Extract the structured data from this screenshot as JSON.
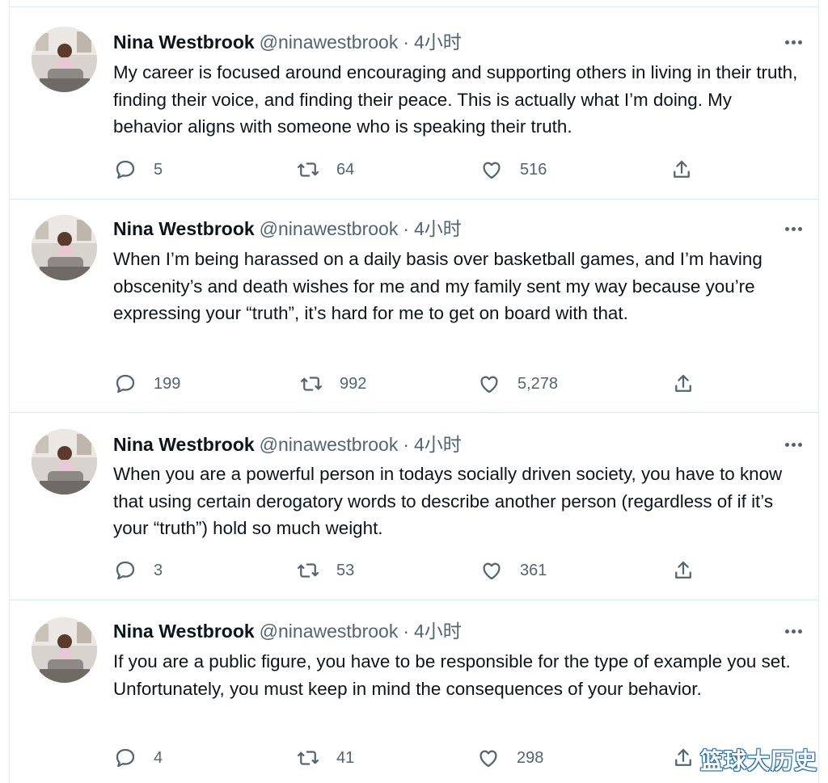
{
  "colors": {
    "text_primary": "#0f1419",
    "text_secondary": "#536471",
    "divider": "#e1e8ed",
    "background": "#ffffff"
  },
  "tweets": [
    {
      "author_name": "Nina Westbrook",
      "author_handle": "@ninawestbrook",
      "separator": "·",
      "timestamp": "4小时",
      "text": "My career is focused around encouraging and supporting others in living in their truth, finding their voice, and finding their peace. This is actually what I’m doing. My behavior aligns with someone who is speaking their truth.",
      "reply_count": "5",
      "retweet_count": "64",
      "like_count": "516",
      "icons": [
        "reply-icon",
        "retweet-icon",
        "like-icon",
        "share-icon",
        "more-icon"
      ]
    },
    {
      "author_name": "Nina Westbrook",
      "author_handle": "@ninawestbrook",
      "separator": "·",
      "timestamp": "4小时",
      "text": "When I’m being harassed on a daily basis over basketball games, and I’m having obscenity’s and death wishes for me and my family sent my way because you’re expressing your “truth”, it’s hard for me to get on board with that.",
      "reply_count": "199",
      "retweet_count": "992",
      "like_count": "5,278",
      "icons": [
        "reply-icon",
        "retweet-icon",
        "like-icon",
        "share-icon",
        "more-icon"
      ]
    },
    {
      "author_name": "Nina Westbrook",
      "author_handle": "@ninawestbrook",
      "separator": "·",
      "timestamp": "4小时",
      "text": "When you are a powerful person in todays socially driven society, you have to know that using certain derogatory words to describe another person (regardless of if it’s your “truth”) hold so much weight.",
      "reply_count": "3",
      "retweet_count": "53",
      "like_count": "361",
      "icons": [
        "reply-icon",
        "retweet-icon",
        "like-icon",
        "share-icon",
        "more-icon"
      ]
    },
    {
      "author_name": "Nina Westbrook",
      "author_handle": "@ninawestbrook",
      "separator": "·",
      "timestamp": "4小时",
      "text": "If you are a public figure, you have to be responsible for the type of example you set. Unfortunately, you must keep in mind the consequences of your behavior.",
      "reply_count": "4",
      "retweet_count": "41",
      "like_count": "298",
      "icons": [
        "reply-icon",
        "retweet-icon",
        "like-icon",
        "share-icon",
        "more-icon"
      ]
    }
  ],
  "watermark": {
    "text": "篮球大历史"
  }
}
